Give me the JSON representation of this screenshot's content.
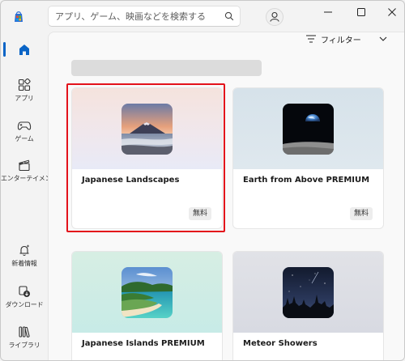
{
  "search": {
    "placeholder": "アプリ、ゲーム、映画などを検索する"
  },
  "sidebar": {
    "items": [
      {
        "label": ""
      },
      {
        "label": "アプリ"
      },
      {
        "label": "ゲーム"
      },
      {
        "label": "エンターテイメント"
      },
      {
        "label": "新着情報"
      },
      {
        "label": "ダウンロード"
      },
      {
        "label": "ライブラリ"
      }
    ]
  },
  "filter": {
    "label": "フィルター"
  },
  "cards": [
    {
      "title": "Japanese Landscapes",
      "badge": "無料",
      "selected": true
    },
    {
      "title": "Earth from Above PREMIUM",
      "badge": "無料"
    },
    {
      "title": "Japanese Islands PREMIUM",
      "badge": ""
    },
    {
      "title": "Meteor Showers",
      "badge": ""
    }
  ],
  "colors": {
    "accent": "#0a64c6",
    "selection": "#e3121b"
  }
}
